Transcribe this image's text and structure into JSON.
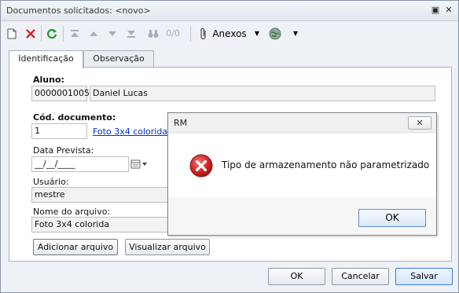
{
  "window": {
    "title": "Documentos solicitados: <novo>",
    "restore_glyph": "▣",
    "close_glyph": "✕"
  },
  "toolbar": {
    "new_icon": "new-document-icon",
    "delete_icon": "delete-icon",
    "refresh_icon": "refresh-icon",
    "first_icon": "first-record-icon",
    "prev_icon": "previous-record-icon",
    "next_icon": "next-record-icon",
    "last_icon": "last-record-icon",
    "search_icon": "binoculars-icon",
    "record_counter": "0/0",
    "attachments_label": "Anexos",
    "dropdown_glyph": "▼"
  },
  "tabs": [
    {
      "label": "Identificação",
      "active": true
    },
    {
      "label": "Observação",
      "active": false
    }
  ],
  "form": {
    "aluno_label": "Aluno:",
    "aluno_code": "0000001005",
    "aluno_name": "Daniel Lucas",
    "cod_documento_label": "Cód. documento:",
    "cod_documento_value": "1",
    "cod_documento_link": "Foto 3x4 colorida",
    "data_prevista_label": "Data Prevista:",
    "data_prevista_value": "__/__/____",
    "usuario_label": "Usuário:",
    "usuario_value": "mestre",
    "nome_arquivo_label": "Nome do arquivo:",
    "nome_arquivo_value": "Foto 3x4 colorida",
    "add_file_button": "Adicionar arquivo",
    "view_file_button": "Visualizar arquivo"
  },
  "footer": {
    "ok": "OK",
    "cancel": "Cancelar",
    "save": "Salvar"
  },
  "dialog": {
    "title": "RM",
    "close_glyph": "✕",
    "message": "Tipo de armazenamento não parametrizado",
    "ok": "OK",
    "icon": "error-icon"
  },
  "colors": {
    "error_red": "#d42a2a",
    "link_blue": "#0033cc",
    "primary_border": "#3d7bd0"
  }
}
